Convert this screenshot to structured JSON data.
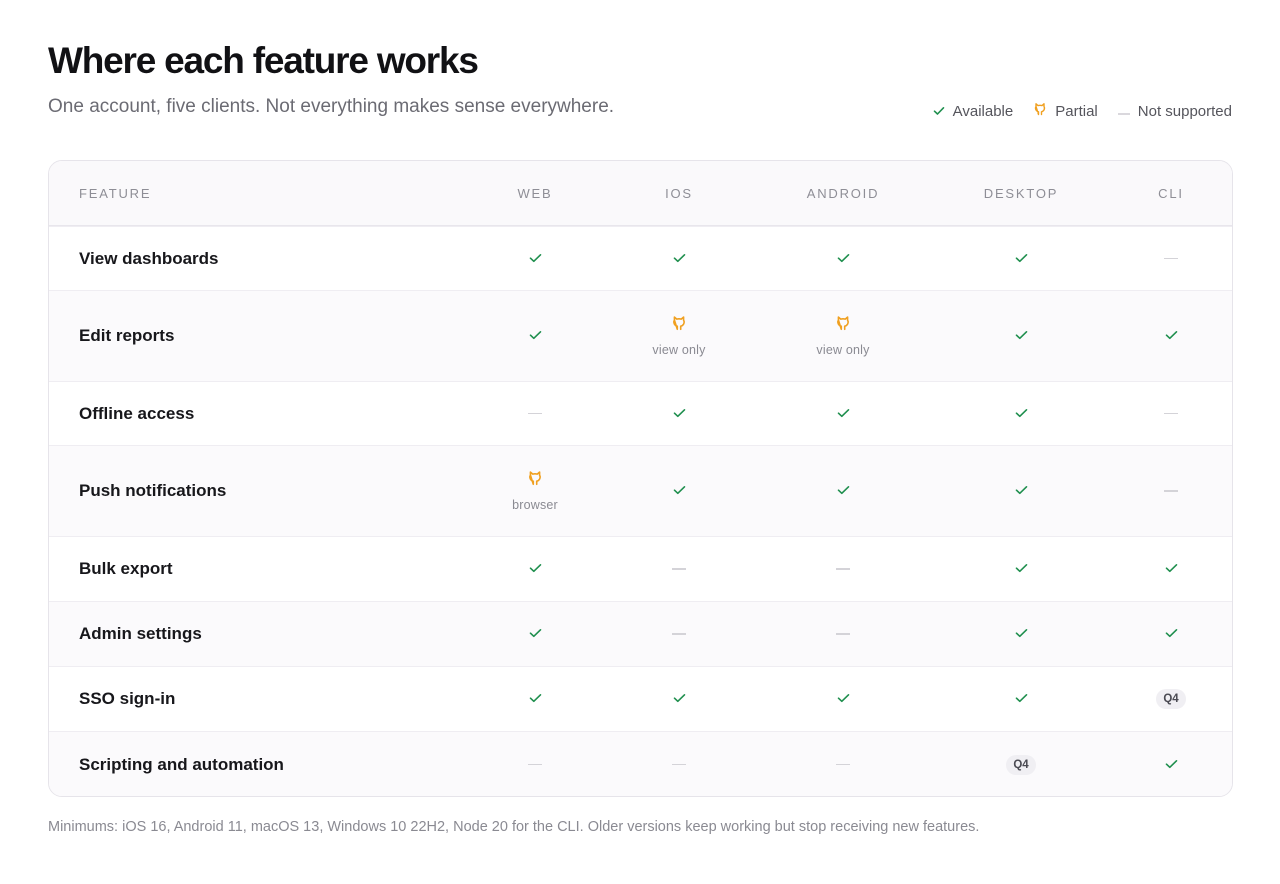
{
  "page": {
    "title": "Where each feature works",
    "subtitle": "One account, five clients. Not everything makes sense everywhere."
  },
  "legend": {
    "available": "Available",
    "partial": "Partial",
    "not_supported": "Not supported"
  },
  "colors": {
    "available": "#1f8f4e",
    "partial": "#f0a020",
    "not_supported": "#d4d3d8"
  },
  "table": {
    "headers": {
      "feature": "FEATURE",
      "web": "WEB",
      "ios": "IOS",
      "android": "ANDROID",
      "desktop": "DESKTOP",
      "cli": "CLI"
    },
    "rows": [
      {
        "feature": "View dashboards",
        "web": {
          "status": "available"
        },
        "ios": {
          "status": "available"
        },
        "android": {
          "status": "available"
        },
        "desktop": {
          "status": "available"
        },
        "cli": {
          "status": "not_supported"
        }
      },
      {
        "feature": "Edit reports",
        "web": {
          "status": "available"
        },
        "ios": {
          "status": "partial",
          "note": "view only"
        },
        "android": {
          "status": "partial",
          "note": "view only"
        },
        "desktop": {
          "status": "available"
        },
        "cli": {
          "status": "available"
        }
      },
      {
        "feature": "Offline access",
        "web": {
          "status": "not_supported"
        },
        "ios": {
          "status": "available"
        },
        "android": {
          "status": "available"
        },
        "desktop": {
          "status": "available"
        },
        "cli": {
          "status": "not_supported"
        }
      },
      {
        "feature": "Push notifications",
        "web": {
          "status": "partial",
          "note": "browser"
        },
        "ios": {
          "status": "available"
        },
        "android": {
          "status": "available"
        },
        "desktop": {
          "status": "available"
        },
        "cli": {
          "status": "not_supported"
        }
      },
      {
        "feature": "Bulk export",
        "web": {
          "status": "available"
        },
        "ios": {
          "status": "not_supported"
        },
        "android": {
          "status": "not_supported"
        },
        "desktop": {
          "status": "available"
        },
        "cli": {
          "status": "available"
        }
      },
      {
        "feature": "Admin settings",
        "web": {
          "status": "available"
        },
        "ios": {
          "status": "not_supported"
        },
        "android": {
          "status": "not_supported"
        },
        "desktop": {
          "status": "available"
        },
        "cli": {
          "status": "available"
        }
      },
      {
        "feature": "SSO sign-in",
        "web": {
          "status": "available"
        },
        "ios": {
          "status": "available"
        },
        "android": {
          "status": "available"
        },
        "desktop": {
          "status": "available"
        },
        "cli": {
          "status": "planned",
          "badge": "Q4"
        }
      },
      {
        "feature": "Scripting and automation",
        "web": {
          "status": "not_supported"
        },
        "ios": {
          "status": "not_supported"
        },
        "android": {
          "status": "not_supported"
        },
        "desktop": {
          "status": "planned",
          "badge": "Q4"
        },
        "cli": {
          "status": "available"
        }
      }
    ]
  },
  "footer": {
    "text": "Minimums: iOS 16, Android 11, macOS 13, Windows 10 22H2, Node 20 for the CLI. Older versions keep working but stop receiving new features."
  }
}
